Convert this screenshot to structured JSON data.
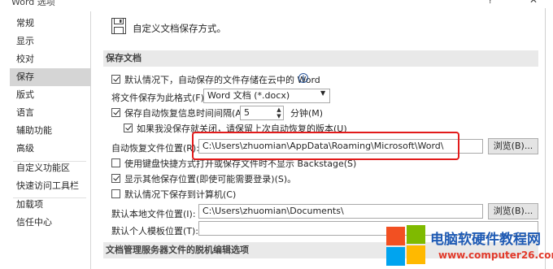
{
  "window": {
    "title": "Word 选项",
    "help": "?",
    "close": "✕"
  },
  "sidebar": {
    "items": [
      {
        "label": "常规"
      },
      {
        "label": "显示"
      },
      {
        "label": "校对"
      },
      {
        "label": "保存"
      },
      {
        "label": "版式"
      },
      {
        "label": "语言"
      },
      {
        "label": "辅助功能"
      },
      {
        "label": "高级"
      },
      {
        "label": "自定义功能区"
      },
      {
        "label": "快速访问工具栏"
      },
      {
        "label": "加载项"
      },
      {
        "label": "信任中心"
      }
    ],
    "selected": "保存"
  },
  "header": {
    "text": "自定义文档保存方式。",
    "icon": "save-document-icon"
  },
  "sections": {
    "save": "保存文档",
    "offline": "文档管理服务器文件的脱机编辑选项"
  },
  "options": {
    "cloud_default": {
      "label": "默认情况下，自动保存的文件存储在云中的 Word",
      "checked": true
    },
    "format_label": "将文件保存为此格式(F):",
    "format_value": "Word 文档 (*.docx)",
    "autorecover": {
      "label": "保存自动恢复信息时间间隔(A)",
      "checked": true
    },
    "autorecover_minutes": "5",
    "minutes_label": "分钟(M)",
    "keep_last": {
      "label": "如果我没保存就关闭，请保留上次自动恢复的版本(U)",
      "checked": true
    },
    "autorecover_location_label": "自动恢复文件位置(R):",
    "autorecover_location_value": "C:\\Users\\zhuomian\\AppData\\Roaming\\Microsoft\\Word\\",
    "browse_label": "浏览(B)...",
    "no_backstage": {
      "label": "使用键盘快捷方式打开或保存文件时不显示 Backstage(S)",
      "checked": false
    },
    "show_more_locations": {
      "label": "显示其他保存位置(即使可能需要登录)(S)。",
      "checked": true
    },
    "save_to_computer": {
      "label": "默认情况下保存到计算机(C)",
      "checked": false
    },
    "local_location_label": "默认本地文件位置(I):",
    "local_location_value": "C:\\Users\\zhuomian\\Documents\\",
    "browse2_label": "浏览(B)...",
    "template_label": "默认个人模板位置(T):",
    "template_value": ""
  },
  "watermark": {
    "cn": "电脑软硬件教程网",
    "url": "www.computer26.com"
  },
  "colors": {
    "highlight": "#e21b1b",
    "selected_nav": "#d5d5d5",
    "section_bar": "#e9e9e9"
  }
}
